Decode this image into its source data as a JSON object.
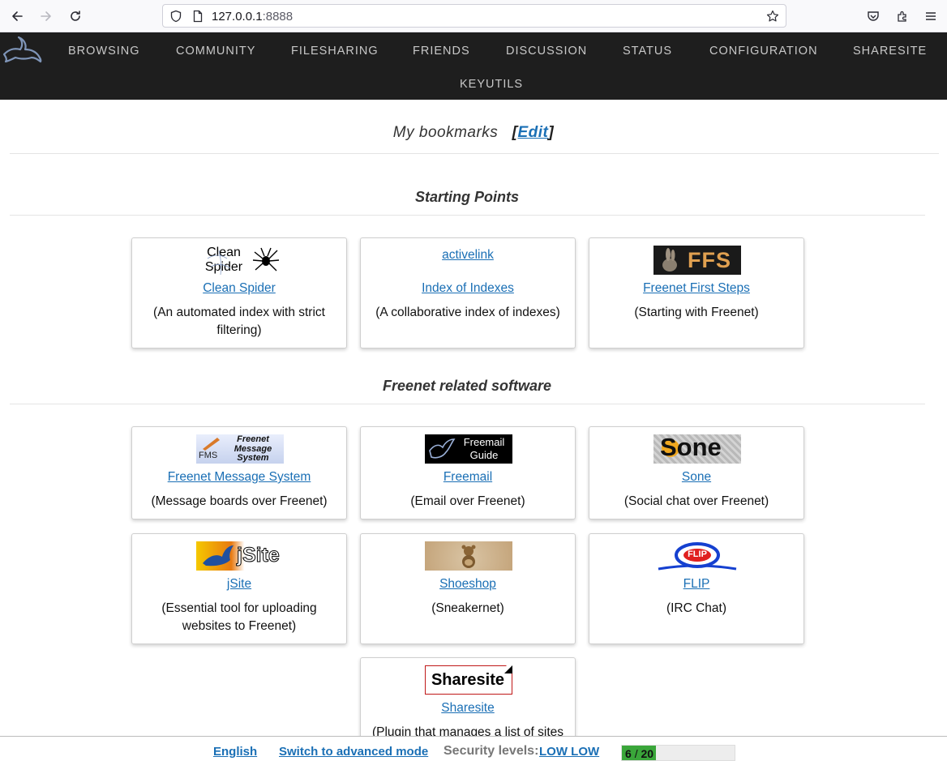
{
  "browser": {
    "url_host": "127.0.0.1",
    "url_port": ":8888"
  },
  "nav": {
    "items": [
      "BROWSING",
      "COMMUNITY",
      "FILESHARING",
      "FRIENDS",
      "DISCUSSION",
      "STATUS",
      "CONFIGURATION",
      "SHARESITE",
      "KEYUTILS"
    ]
  },
  "bookmarks": {
    "title": "My bookmarks",
    "edit_open": "[",
    "edit_label": "Edit",
    "edit_close": "]"
  },
  "sections": [
    {
      "title": "Starting Points",
      "cards": [
        {
          "image_text_1": "Clean",
          "image_text_2": "Spider",
          "link": "Clean Spider",
          "desc": "(An automated index with strict filtering)"
        },
        {
          "image_alt": "activelink",
          "link": "Index of Indexes",
          "desc": "(A collaborative index of indexes)"
        },
        {
          "image_text": "FFS",
          "link": "Freenet First Steps",
          "desc": "(Starting with Freenet)"
        }
      ]
    },
    {
      "title": "Freenet related software",
      "cards": [
        {
          "image_text_1": "Freenet",
          "image_text_2": "Message",
          "image_text_3": "System",
          "image_text_4": "FMS",
          "link": "Freenet Message System",
          "desc": "(Message boards over Freenet)"
        },
        {
          "image_text_1": "Freemail",
          "image_text_2": "Guide",
          "link": "Freemail",
          "desc": "(Email over Freenet)"
        },
        {
          "image_text": "Sone",
          "link": "Sone",
          "desc": "(Social chat over Freenet)"
        },
        {
          "image_text": "jSite",
          "link": "jSite",
          "desc": "(Essential tool for uploading websites to Freenet)"
        },
        {
          "link": "Shoeshop",
          "desc": "(Sneakernet)"
        },
        {
          "image_text": "FLIP",
          "link": "FLIP",
          "desc": "(IRC Chat)"
        },
        {
          "image_text": "Sharesite",
          "link": "Sharesite",
          "desc": "(Plugin that manages a list of sites"
        }
      ]
    }
  ],
  "footer": {
    "language": "English",
    "mode": "Switch to advanced mode",
    "security_label": "Security levels:",
    "security_value": "LOW LOW",
    "peers_connected": 6,
    "peers_sep": "/",
    "peers_total": 20,
    "peers_fraction": 0.3
  },
  "colors": {
    "nav_bg": "#1e1e1e",
    "link": "#1a6fb5",
    "peer_bar": "#3aa63a"
  }
}
